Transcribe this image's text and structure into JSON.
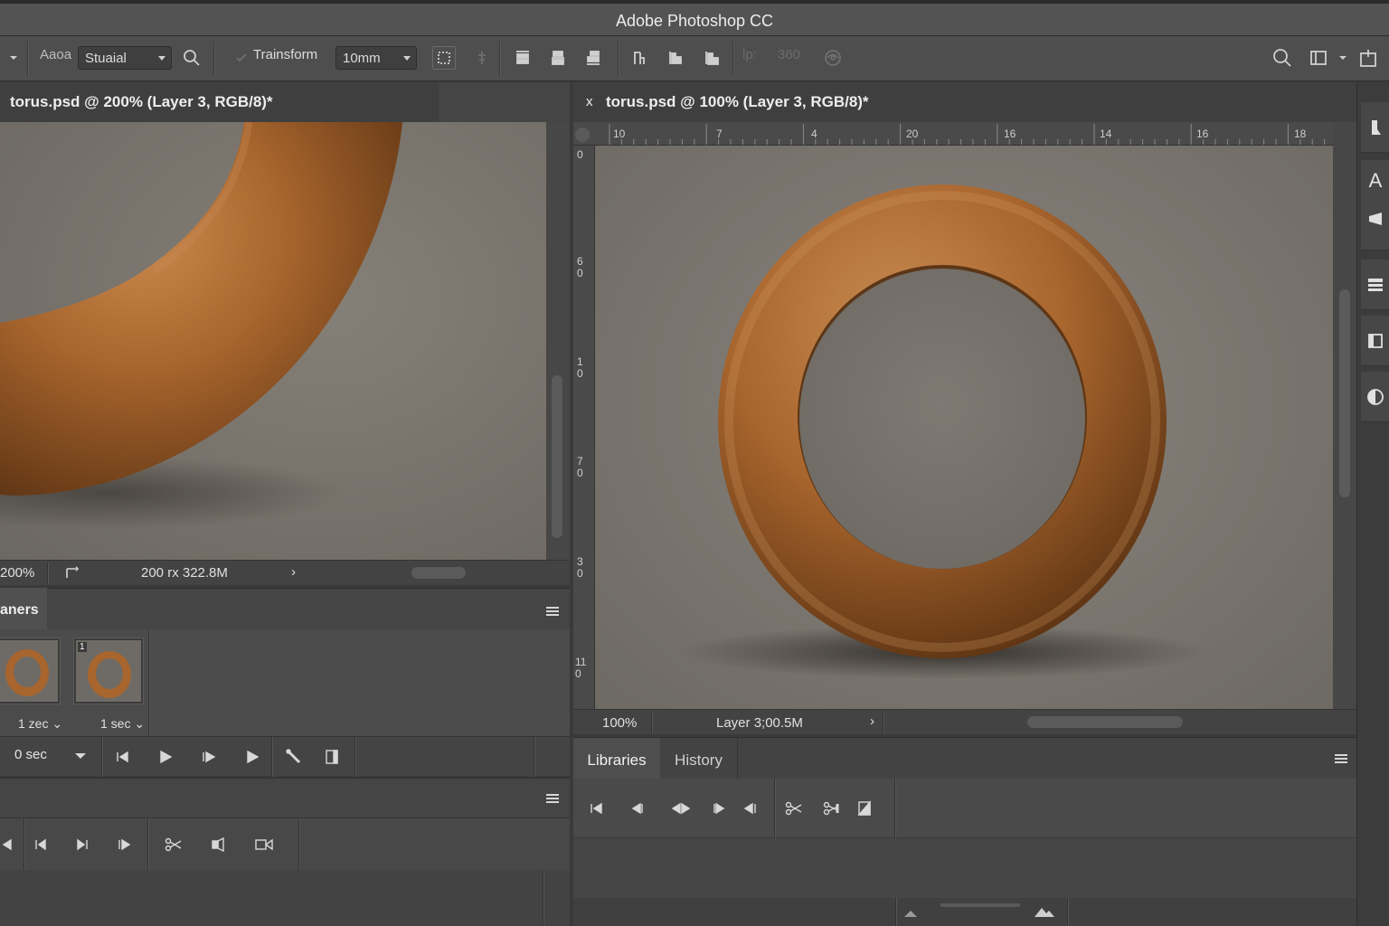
{
  "app": {
    "title": "Adobe Photoshop CC"
  },
  "options_bar": {
    "font_label": "Aaoa",
    "font_style": "Stuaial",
    "transform_label": "Trainsform",
    "size_value": "10mm",
    "angle_label": "lp:",
    "angle_value": "360"
  },
  "left_document": {
    "tab_title": "torus.psd @ 200% (Layer 3, RGB/8)*",
    "status": {
      "zoom": "200%",
      "info": "200 rx 322.8M"
    }
  },
  "right_document": {
    "close_glyph": "x",
    "tab_title": "torus.psd @ 100% (Layer 3, RGB/8)*",
    "ruler_top": [
      "10",
      "7",
      "4",
      "20",
      "16",
      "14",
      "16",
      "18"
    ],
    "ruler_left": [
      "0",
      "6\n0",
      "1\n0",
      "7\n0",
      "3\n0",
      "11\n0"
    ],
    "status": {
      "zoom": "100%",
      "info": "Layer 3;00.5M"
    }
  },
  "frames_panel": {
    "tab_label": "aners",
    "frames": [
      {
        "number": "",
        "delay": "1 zec"
      },
      {
        "number": "1",
        "delay": "1 sec"
      }
    ],
    "loop_value": "0 sec"
  },
  "libraries_panel": {
    "tabs": [
      {
        "label": "Libraries",
        "active": true
      },
      {
        "label": "History",
        "active": false
      }
    ]
  },
  "colors": {
    "torus": "#a8652d",
    "canvas": "#7a756e",
    "panel": "#4a4a4a"
  }
}
